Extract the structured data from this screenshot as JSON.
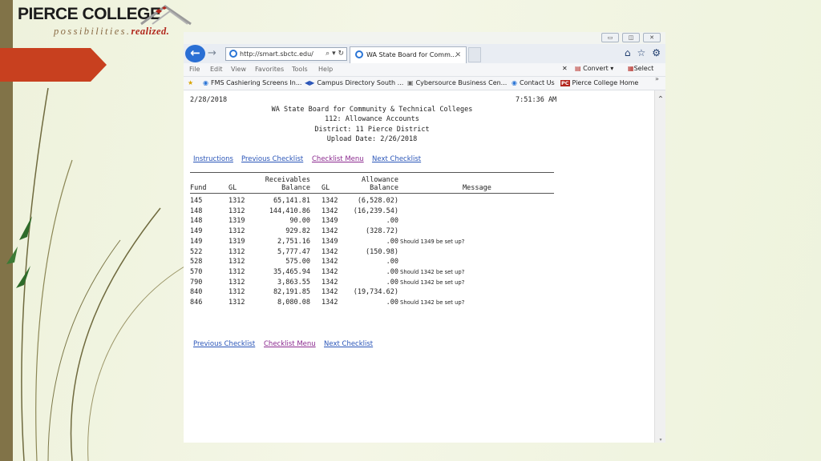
{
  "slide": {
    "logo_title": "PIERCE COLLEGE",
    "logo_sub": "possibilities.",
    "logo_sub_bold": "realized."
  },
  "browser": {
    "url": "http://smart.sbctc.edu/",
    "tab_title": "WA State Board for Comm...",
    "menu": [
      "File",
      "Edit",
      "View",
      "Favorites",
      "Tools",
      "Help"
    ],
    "convert_label": "Convert",
    "select_label": "Select",
    "favorites": [
      "FMS Cashiering Screens In...",
      "Campus Directory  South ...",
      "Cybersource Business Cen...",
      "Contact Us",
      "Pierce College Home"
    ]
  },
  "report": {
    "date": "2/28/2018",
    "time": "7:51:36 AM",
    "org": "WA State Board for Community & Technical Colleges",
    "report_name": "112: Allowance Accounts",
    "district": "District: 11  Pierce District",
    "upload": "Upload Date: 2/26/2018",
    "links_top": [
      "Instructions",
      "Previous Checklist",
      "Checklist Menu",
      "Next Checklist"
    ],
    "links_bottom": [
      "Previous Checklist",
      "Checklist Menu",
      "Next Checklist"
    ],
    "headers": {
      "fund": "Fund",
      "gl1": "GL",
      "recv_top": "Receivables",
      "recv_bottom": "Balance",
      "gl2": "GL",
      "allow_top": "Allowance",
      "allow_bottom": "Balance",
      "message": "Message"
    },
    "rows": [
      {
        "fund": "145",
        "gl": "1312",
        "recv": "65,141.81",
        "gl2": "1342",
        "allow": "(6,528.02)",
        "msg": ""
      },
      {
        "fund": "148",
        "gl": "1312",
        "recv": "144,410.86",
        "gl2": "1342",
        "allow": "(16,239.54)",
        "msg": ""
      },
      {
        "fund": "148",
        "gl": "1319",
        "recv": "90.00",
        "gl2": "1349",
        "allow": ".00",
        "msg": ""
      },
      {
        "fund": "149",
        "gl": "1312",
        "recv": "929.82",
        "gl2": "1342",
        "allow": "(328.72)",
        "msg": ""
      },
      {
        "fund": "149",
        "gl": "1319",
        "recv": "2,751.16",
        "gl2": "1349",
        "allow": ".00",
        "msg": "Should 1349 be set up?"
      },
      {
        "fund": "522",
        "gl": "1312",
        "recv": "5,777.47",
        "gl2": "1342",
        "allow": "(150.98)",
        "msg": ""
      },
      {
        "fund": "528",
        "gl": "1312",
        "recv": "575.00",
        "gl2": "1342",
        "allow": ".00",
        "msg": ""
      },
      {
        "fund": "570",
        "gl": "1312",
        "recv": "35,465.94",
        "gl2": "1342",
        "allow": ".00",
        "msg": "Should 1342 be set up?"
      },
      {
        "fund": "790",
        "gl": "1312",
        "recv": "3,863.55",
        "gl2": "1342",
        "allow": ".00",
        "msg": "Should 1342 be set up?"
      },
      {
        "fund": "840",
        "gl": "1312",
        "recv": "82,191.85",
        "gl2": "1342",
        "allow": "(19,734.62)",
        "msg": ""
      },
      {
        "fund": "846",
        "gl": "1312",
        "recv": "8,080.08",
        "gl2": "1342",
        "allow": ".00",
        "msg": "Should 1342 be set up?"
      }
    ]
  },
  "colors": {
    "accent_red": "#c8401f",
    "sidebar": "#817348",
    "link": "#2a55b8",
    "visited_link": "#8b2a8f"
  }
}
